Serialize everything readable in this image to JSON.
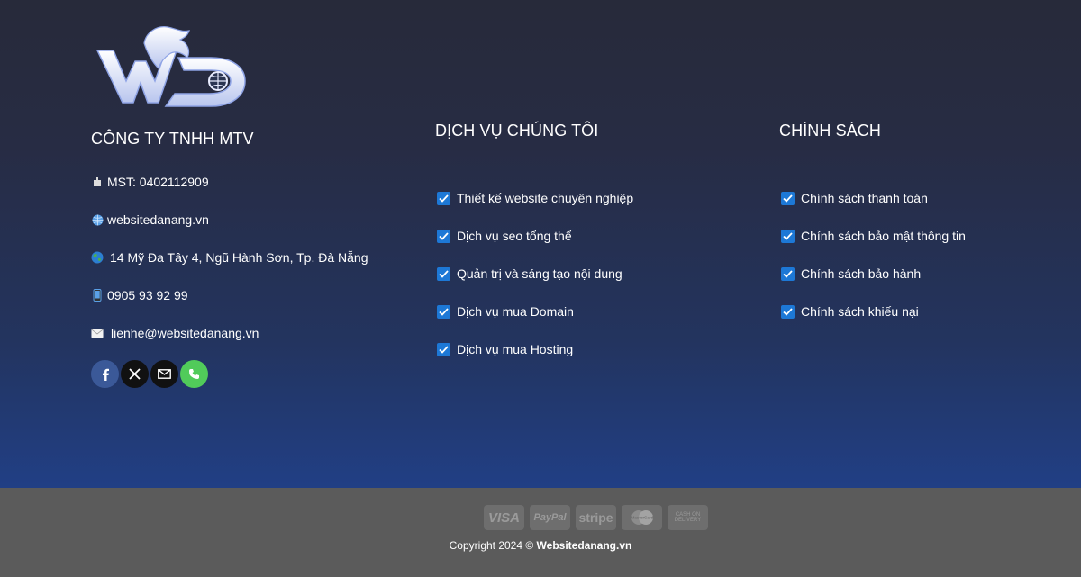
{
  "company": {
    "title": "CÔNG TY TNHH MTV",
    "mst": "MST: 0402112909",
    "website": "websitedanang.vn",
    "address": "14 Mỹ Đa Tây 4, Ngũ Hành Sơn, Tp. Đà Nẵng",
    "phone": "0905 93 92 99",
    "email": "lienhe@websitedanang.vn",
    "icons": [
      "office-icon",
      "globe-icon",
      "earth-icon",
      "mobile-phone-icon",
      "envelope-icon"
    ]
  },
  "services": {
    "title": "DỊCH VỤ CHÚNG TÔI",
    "items": [
      "Thiết kế website chuyên nghiệp",
      "Dịch vụ seo tổng thể",
      "Quản trị và sáng tạo nội dung",
      "Dịch vụ mua Domain",
      "Dịch vụ mua Hosting"
    ]
  },
  "policies": {
    "title": "CHÍNH SÁCH",
    "items": [
      "Chính sách thanh toán",
      "Chính sách bảo mật thông tin",
      "Chính sách bảo hành",
      "Chính sách khiếu nại"
    ]
  },
  "social": [
    "facebook-icon",
    "x-icon",
    "mail-icon",
    "phone-icon"
  ],
  "payments": {
    "visa": "VISA",
    "paypal": "PayPal",
    "stripe": "stripe",
    "cod": "CASH ON DELIVERY"
  },
  "footer": {
    "copyright_prefix": "Copyright 2024 ©",
    "brand": "Websitedanang.vn"
  },
  "colors": {
    "check": "#1d78d6",
    "facebook": "#3b5998",
    "phone": "#51cb5a",
    "bottom_bar": "#5b5b5b"
  }
}
